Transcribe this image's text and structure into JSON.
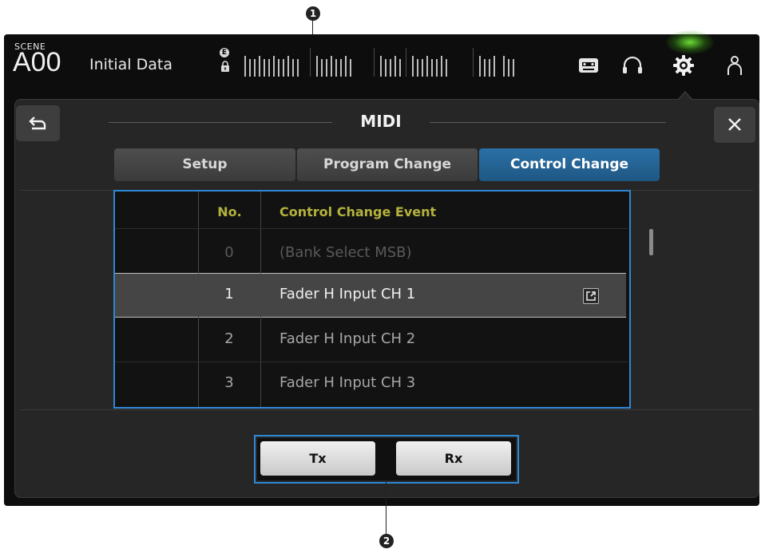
{
  "scene": {
    "label": "SCENE",
    "number": "A00",
    "name": "Initial Data",
    "badge": "E"
  },
  "window": {
    "title": "MIDI"
  },
  "tabs": [
    {
      "label": "Setup",
      "active": false
    },
    {
      "label": "Program Change",
      "active": false
    },
    {
      "label": "Control Change",
      "active": true
    }
  ],
  "table": {
    "headers": {
      "no": "No.",
      "event": "Control Change Event"
    },
    "rows": [
      {
        "no": "0",
        "event": "(Bank Select MSB)",
        "state": "disabled"
      },
      {
        "no": "1",
        "event": "Fader H Input CH 1",
        "state": "selected"
      },
      {
        "no": "2",
        "event": "Fader H Input CH 2",
        "state": "normal"
      },
      {
        "no": "3",
        "event": "Fader H Input CH 3",
        "state": "normal"
      }
    ]
  },
  "buttons": {
    "tx": "Tx",
    "rx": "Rx"
  },
  "callouts": [
    "1",
    "2"
  ],
  "colors": {
    "accent_blue": "#2f88d6",
    "active_tab": "#2a70a6",
    "header_text": "#b4b23c",
    "gear_glow": "#6fe03c"
  },
  "icons": [
    "lock-icon",
    "recorder-icon",
    "headphones-icon",
    "gear-icon",
    "user-icon",
    "back-arrow-icon",
    "close-icon",
    "jump-icon"
  ]
}
